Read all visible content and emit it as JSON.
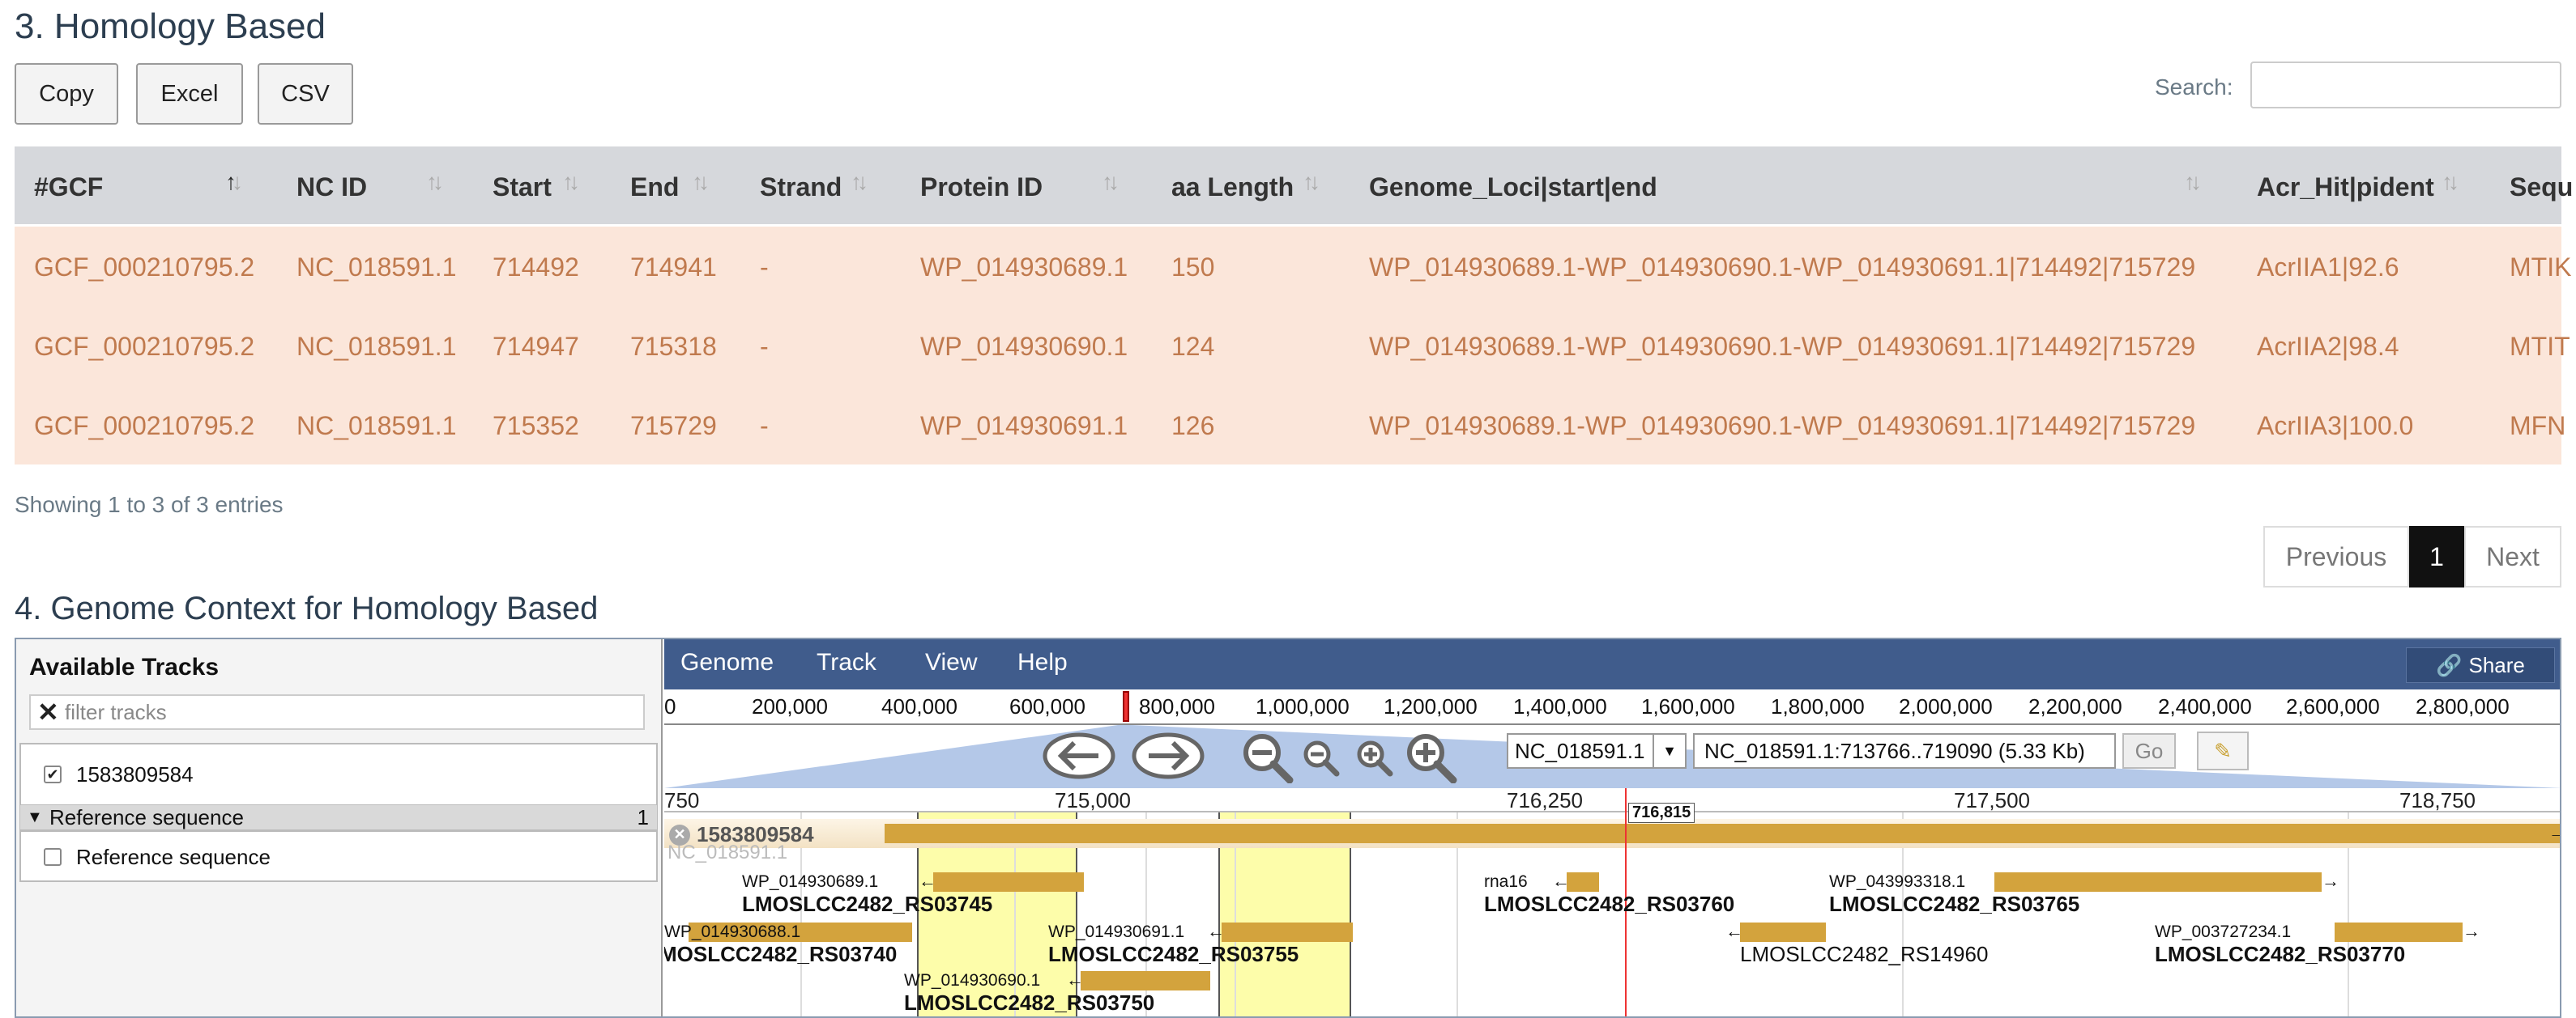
{
  "section3": {
    "title": "3. Homology Based",
    "buttons": {
      "copy": "Copy",
      "excel": "Excel",
      "csv": "CSV"
    },
    "search_label": "Search:",
    "search_value": "",
    "columns": [
      "#GCF",
      "NC ID",
      "Start",
      "End",
      "Strand",
      "Protein ID",
      "aa Length",
      "Genome_Loci|start|end",
      "Acr_Hit|pident",
      "Sequ"
    ],
    "sort_icon": "sort-arrows-icon",
    "rows": [
      [
        "GCF_000210795.2",
        "NC_018591.1",
        "714492",
        "714941",
        "-",
        "WP_014930689.1",
        "150",
        "WP_014930689.1-WP_014930690.1-WP_014930691.1|714492|715729",
        "AcrIIA1|92.6",
        "MTIK"
      ],
      [
        "GCF_000210795.2",
        "NC_018591.1",
        "714947",
        "715318",
        "-",
        "WP_014930690.1",
        "124",
        "WP_014930689.1-WP_014930690.1-WP_014930691.1|714492|715729",
        "AcrIIA2|98.4",
        "MTIT"
      ],
      [
        "GCF_000210795.2",
        "NC_018591.1",
        "715352",
        "715729",
        "-",
        "WP_014930691.1",
        "126",
        "WP_014930689.1-WP_014930690.1-WP_014930691.1|714492|715729",
        "AcrIIA3|100.0",
        "MFN"
      ]
    ],
    "entries_text": "Showing 1 to 3 of 3 entries",
    "pager": {
      "previous": "Previous",
      "page": "1",
      "next": "Next"
    }
  },
  "section4": {
    "title": "4. Genome Context for Homology Based",
    "panel": {
      "title": "Available Tracks",
      "filter_placeholder": "filter tracks",
      "track_checked": "1583809584",
      "ref_header": "Reference sequence",
      "ref_count": "1",
      "ref_track": "Reference sequence"
    },
    "menu": [
      "Genome",
      "Track",
      "View",
      "Help"
    ],
    "share": "Share",
    "overview_ticks": [
      "0",
      "200,000",
      "400,000",
      "600,000",
      "800,000",
      "1,000,000",
      "1,200,000",
      "1,400,000",
      "1,600,000",
      "1,800,000",
      "2,000,000",
      "2,200,000",
      "2,400,000",
      "2,600,000",
      "2,800,000"
    ],
    "refseq": "NC_018591.1",
    "location": "NC_018591.1:713766..719090 (5.33 Kb)",
    "go": "Go",
    "scale_labels": [
      "750",
      "715,000",
      "716,250",
      "717,500",
      "718,750"
    ],
    "position_label": "716,815",
    "track_name": "1583809584",
    "track_faded": "NC_018591.1",
    "features": [
      {
        "protein": "WP_014930689.1",
        "locus": "LMOSLCC2482_RS03745"
      },
      {
        "protein": "WP_014930688.1",
        "locus": "MOSLCC2482_RS03740"
      },
      {
        "protein": "WP_014930691.1",
        "locus": "LMOSLCC2482_RS03755"
      },
      {
        "protein": "WP_014930690.1",
        "locus": "LMOSLCC2482_RS03750"
      },
      {
        "protein": "rna16",
        "locus": "LMOSLCC2482_RS03760"
      },
      {
        "protein": "WP_043993318.1",
        "locus": "LMOSLCC2482_RS03765"
      },
      {
        "protein": "",
        "locus": "LMOSLCC2482_RS14960"
      },
      {
        "protein": "WP_003727234.1",
        "locus": "LMOSLCC2482_RS03770"
      }
    ]
  },
  "colors": {
    "row_bg": "#fbe6da",
    "row_text": "#c07a4e",
    "menubar": "#405c8c",
    "feature": "#d3a33d",
    "highlight": "#fdfdaa"
  }
}
